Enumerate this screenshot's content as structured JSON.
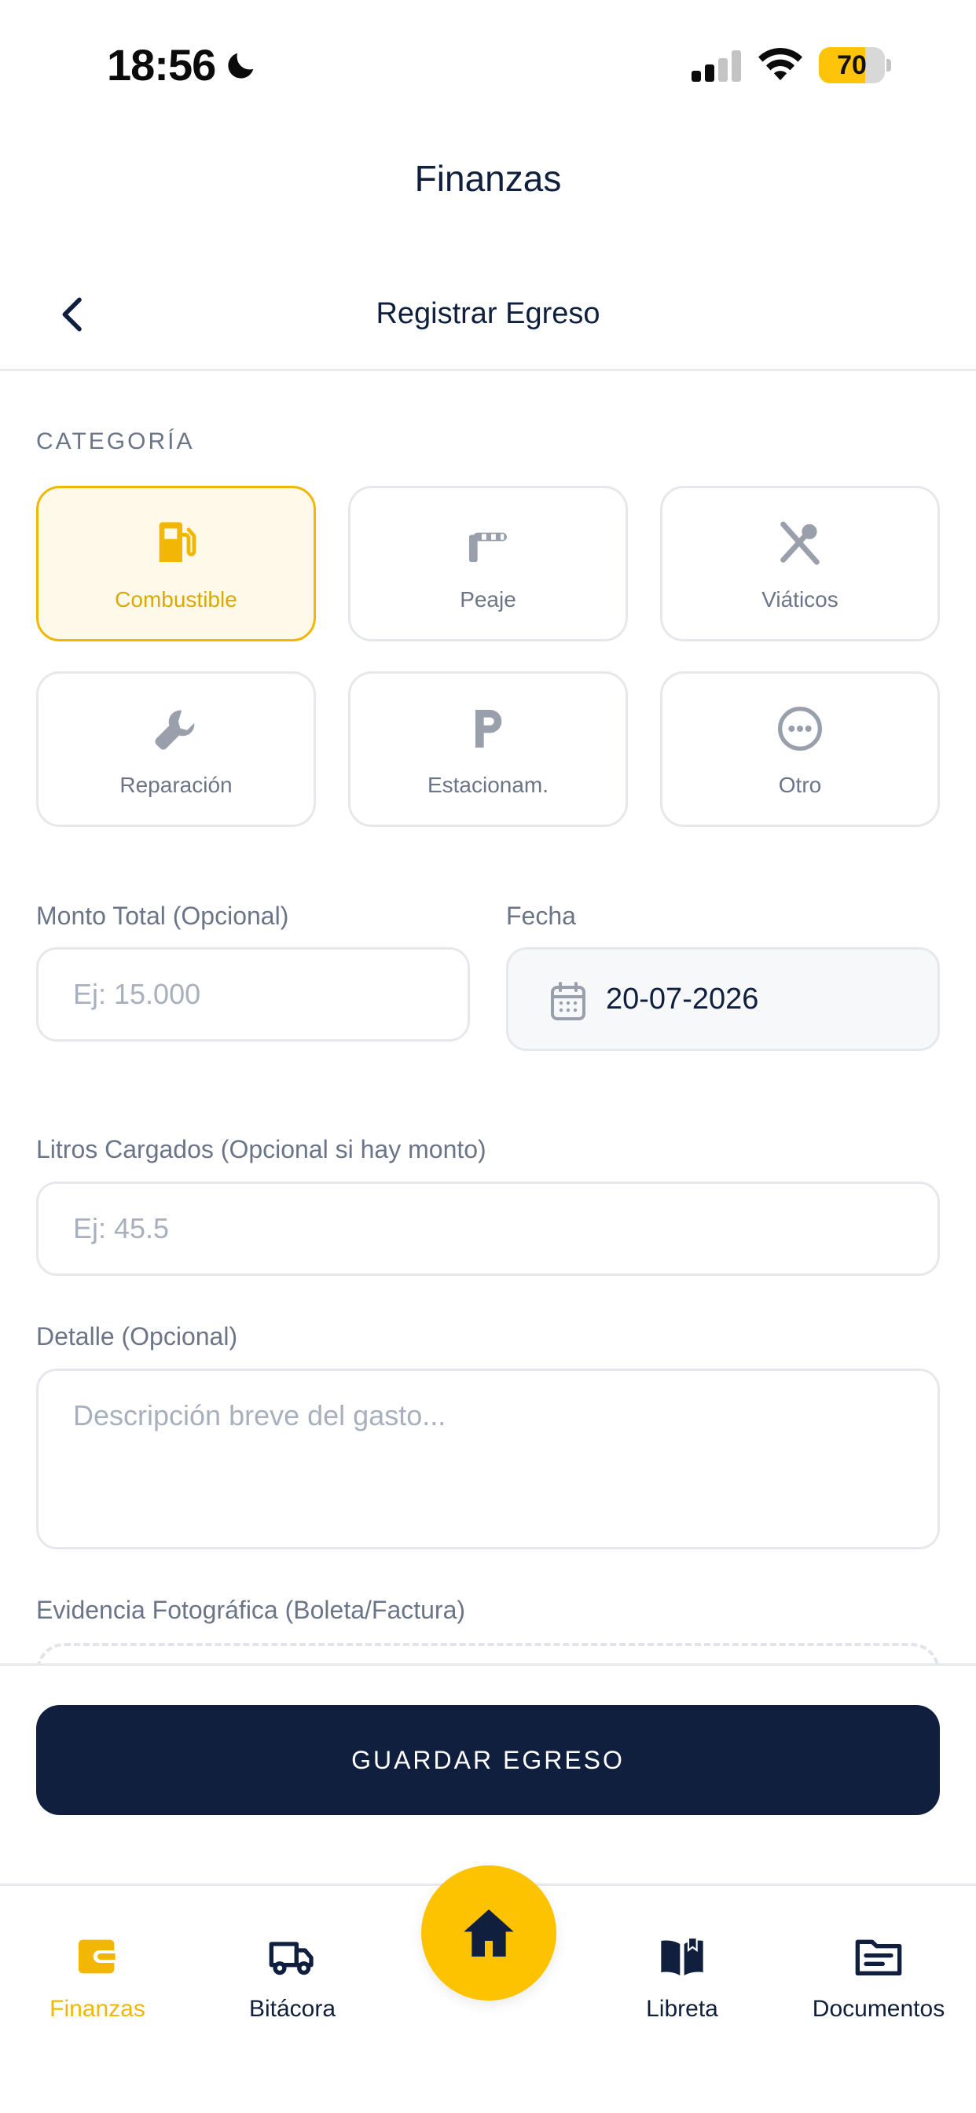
{
  "status_bar": {
    "time": "18:56",
    "battery": "70",
    "battery_level": 0.7
  },
  "app": {
    "title": "Finanzas"
  },
  "header": {
    "title": "Registrar Egreso",
    "back_icon": "chevron-left-icon"
  },
  "category": {
    "label": "CATEGORÍA",
    "items": [
      {
        "label": "Combustible",
        "icon": "fuel-pump-icon",
        "selected": true
      },
      {
        "label": "Peaje",
        "icon": "toll-barrier-icon",
        "selected": false
      },
      {
        "label": "Viáticos",
        "icon": "utensils-icon",
        "selected": false
      },
      {
        "label": "Reparación",
        "icon": "wrench-icon",
        "selected": false
      },
      {
        "label": "Estacionam.",
        "icon": "parking-icon",
        "selected": false
      },
      {
        "label": "Otro",
        "icon": "more-circle-icon",
        "selected": false
      }
    ]
  },
  "form": {
    "amount": {
      "label": "Monto Total (Opcional)",
      "placeholder": "Ej: 15.000",
      "value": ""
    },
    "date": {
      "label": "Fecha",
      "value": "20-07-2026"
    },
    "liters": {
      "label": "Litros Cargados (Opcional si hay monto)",
      "placeholder": "Ej: 45.5",
      "value": ""
    },
    "detail": {
      "label": "Detalle (Opcional)",
      "placeholder": "Descripción breve del gasto...",
      "value": ""
    },
    "evidence": {
      "label": "Evidencia Fotográfica (Boleta/Factura)"
    }
  },
  "actions": {
    "save_label": "GUARDAR EGRESO"
  },
  "bottom_nav": {
    "items": [
      {
        "label": "Finanzas",
        "icon": "wallet-icon",
        "active": true
      },
      {
        "label": "Bitácora",
        "icon": "truck-icon",
        "active": false
      },
      {
        "label": "Libreta",
        "icon": "book-icon",
        "active": false
      },
      {
        "label": "Documentos",
        "icon": "document-icon",
        "active": false
      }
    ],
    "home_icon": "home-icon"
  },
  "colors": {
    "primary": "#0f1f3d",
    "accent": "#f2b705",
    "fab": "#fdc300",
    "muted": "#6b7587",
    "selected_bg": "#fff9ea"
  }
}
